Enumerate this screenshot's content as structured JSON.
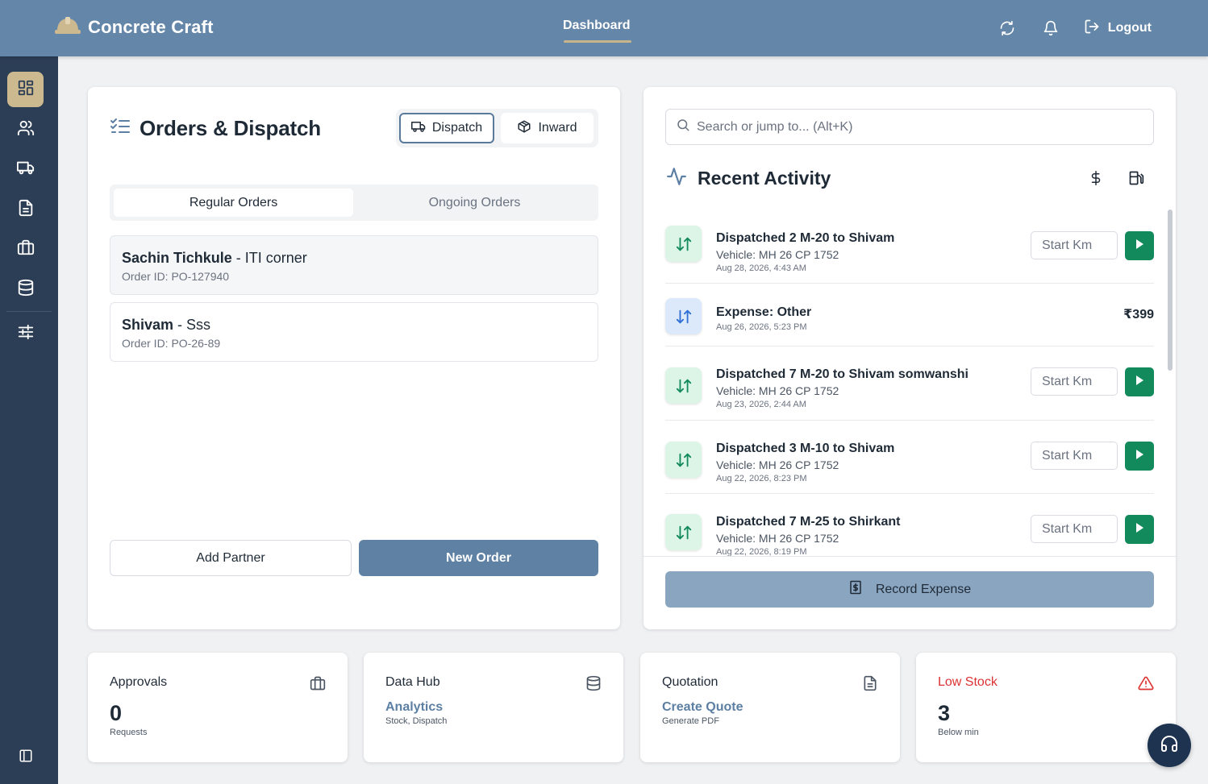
{
  "header": {
    "brand": "Concrete Craft",
    "nav_active": "Dashboard",
    "logout_label": "Logout"
  },
  "sidebar": {
    "items": [
      {
        "icon": "dashboard-grid-icon",
        "active": true
      },
      {
        "icon": "users-icon"
      },
      {
        "icon": "truck-icon"
      },
      {
        "icon": "document-icon"
      },
      {
        "icon": "briefcase-icon"
      },
      {
        "icon": "database-icon"
      },
      {
        "icon": "sliders-icon"
      }
    ],
    "footer_icon": "panel-toggle-icon"
  },
  "orders": {
    "title": "Orders & Dispatch",
    "toggle": {
      "dispatch": "Dispatch",
      "inward": "Inward",
      "active": "dispatch"
    },
    "tabs": {
      "regular": "Regular Orders",
      "ongoing": "Ongoing Orders",
      "active": "regular"
    },
    "rows": [
      {
        "partner": "Sachin Tichkule",
        "site": "ITI corner",
        "order_id": "Order ID: PO-127940"
      },
      {
        "partner": "Shivam",
        "site": "Sss",
        "order_id": "Order ID: PO-26-89"
      }
    ],
    "add_partner": "Add Partner",
    "new_order": "New Order"
  },
  "activity": {
    "search_placeholder": "Search or jump to... (Alt+K)",
    "title": "Recent Activity",
    "start_km_placeholder": "Start Km",
    "items": [
      {
        "type": "dispatch",
        "title": "Dispatched 2 M-20 to Shivam",
        "vehicle": "Vehicle: MH 26 CP 1752",
        "date": "Aug 28, 2026, 4:43 AM"
      },
      {
        "type": "expense",
        "title": "Expense: Other",
        "amount": "₹399",
        "date": "Aug 26, 2026, 5:23 PM"
      },
      {
        "type": "dispatch",
        "title": "Dispatched 7 M-20 to Shivam somwanshi",
        "vehicle": "Vehicle: MH 26 CP 1752",
        "date": "Aug 23, 2026, 2:44 AM"
      },
      {
        "type": "dispatch",
        "title": "Dispatched 3 M-10 to Shivam",
        "vehicle": "Vehicle: MH 26 CP 1752",
        "date": "Aug 22, 2026, 8:23 PM"
      },
      {
        "type": "dispatch",
        "title": "Dispatched 7 M-25 to Shirkant",
        "vehicle": "Vehicle: MH 26 CP 1752",
        "date": "Aug 22, 2026, 8:19 PM"
      }
    ],
    "record_expense": "Record Expense"
  },
  "stats": {
    "approvals": {
      "label": "Approvals",
      "value": "0",
      "sub": "Requests"
    },
    "datahub": {
      "label": "Data Hub",
      "link": "Analytics",
      "sub": "Stock, Dispatch"
    },
    "quotation": {
      "label": "Quotation",
      "link": "Create Quote",
      "sub": "Generate PDF"
    },
    "lowstock": {
      "label": "Low Stock",
      "value": "3",
      "sub": "Below min"
    }
  },
  "colors": {
    "header": "#6486a8",
    "sidebar": "#2c3e55",
    "accent_gold": "#cdb98f",
    "primary_button": "#5f81a4",
    "play_green": "#138a5b",
    "alert_red": "#dc3232"
  }
}
